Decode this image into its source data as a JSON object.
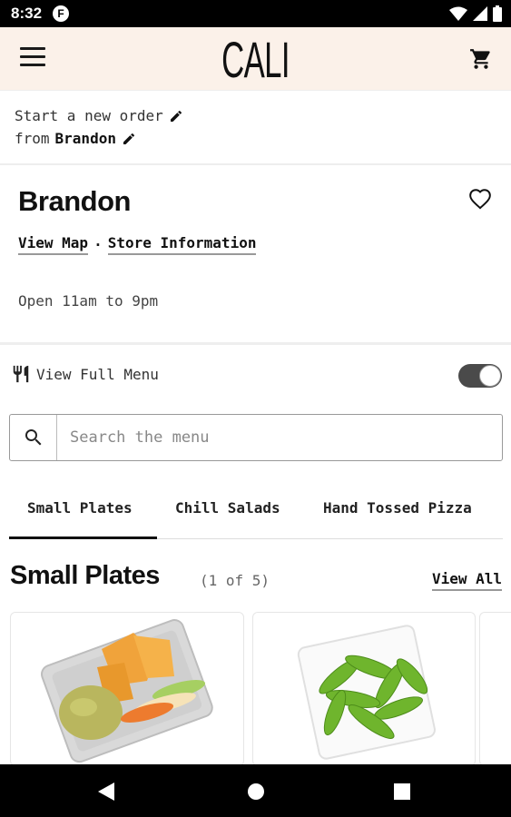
{
  "status_bar": {
    "time": "8:32",
    "app_badge": "F"
  },
  "header": {
    "logo": "CALI"
  },
  "order": {
    "start_label": "Start a new order",
    "from_prefix": "from",
    "location": "Brandon"
  },
  "store": {
    "name": "Brandon",
    "view_map": "View Map",
    "separator": "·",
    "store_info": "Store Information",
    "hours": "Open 11am to 9pm"
  },
  "full_menu": {
    "label": "View Full Menu",
    "toggle_on": true
  },
  "search": {
    "placeholder": "Search the menu"
  },
  "tabs": [
    {
      "label": "Small Plates",
      "active": true
    },
    {
      "label": "Chill Salads",
      "active": false
    },
    {
      "label": "Hand Tossed Pizza",
      "active": false
    }
  ],
  "section": {
    "title": "Small Plates",
    "count": "(1 of 5)",
    "view_all": "View All"
  },
  "cards": [
    {
      "icon": "guacamole-chips-dish-image"
    },
    {
      "icon": "edamame-bowl-image"
    },
    {
      "icon": "partial-card"
    }
  ],
  "colors": {
    "header_bg": "#fbf1e9",
    "status_bg": "#000000",
    "text": "#1a1a1a"
  }
}
